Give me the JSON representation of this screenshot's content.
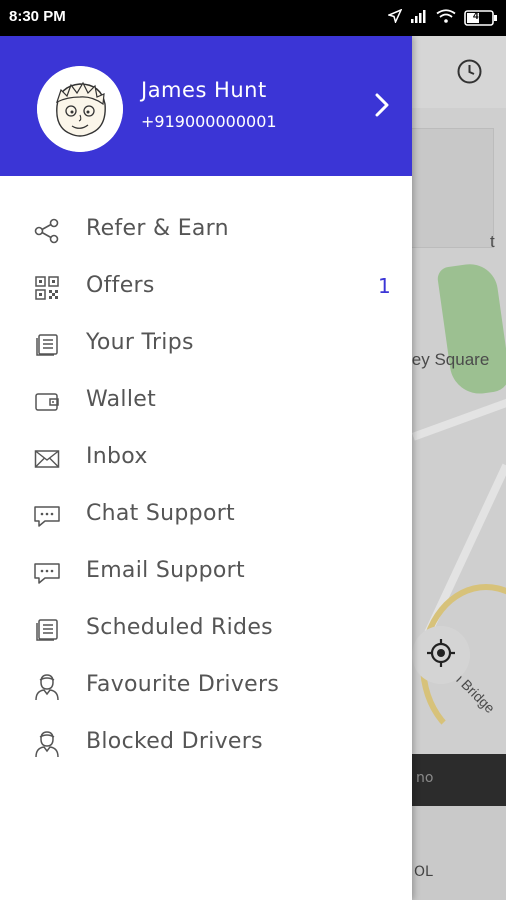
{
  "status_bar": {
    "time": "8:30 PM",
    "battery_level": "49",
    "icons": [
      "location-arrow-icon",
      "signal-icon",
      "wifi-icon",
      "battery-icon"
    ]
  },
  "map": {
    "street_label": "ley Square",
    "bridge_label": "n Bridge",
    "edge_label_1": "t",
    "bottom_dark_text": "no",
    "bottom_light_text": "OL"
  },
  "drawer": {
    "header": {
      "name": "James Hunt",
      "phone": "+919000000001",
      "background_color": "#3b35d6"
    },
    "menu_items": [
      {
        "label": "Refer & Earn",
        "icon": "share-icon"
      },
      {
        "label": "Offers",
        "icon": "qr-code-icon",
        "badge": "1"
      },
      {
        "label": "Your Trips",
        "icon": "document-icon"
      },
      {
        "label": "Wallet",
        "icon": "wallet-icon"
      },
      {
        "label": "Inbox",
        "icon": "mail-icon"
      },
      {
        "label": "Chat Support",
        "icon": "chat-icon"
      },
      {
        "label": "Email Support",
        "icon": "chat-icon"
      },
      {
        "label": "Scheduled Rides",
        "icon": "document-icon"
      },
      {
        "label": "Favourite Drivers",
        "icon": "driver-icon"
      },
      {
        "label": "Blocked Drivers",
        "icon": "driver-icon"
      }
    ]
  }
}
